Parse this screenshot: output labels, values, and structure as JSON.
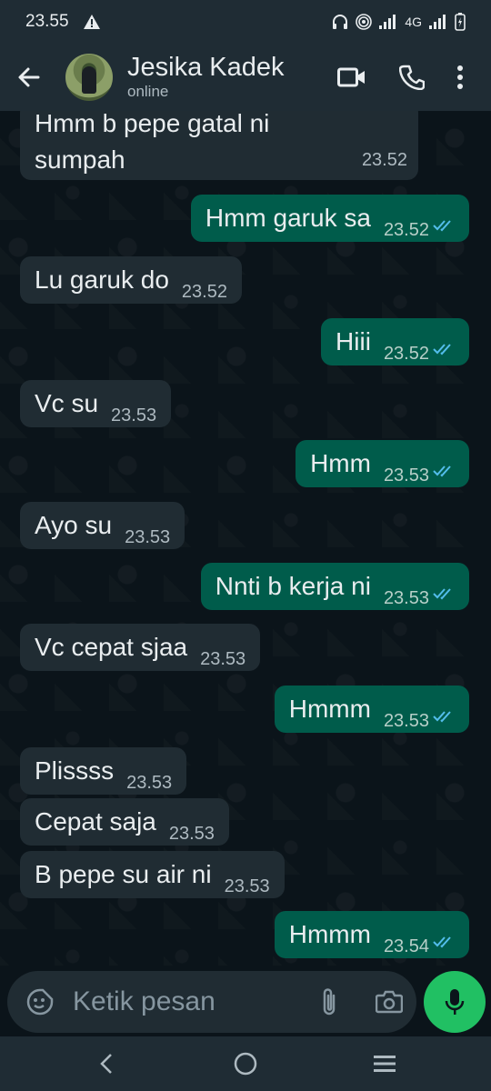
{
  "statusbar": {
    "time": "23.55",
    "network": "4G"
  },
  "header": {
    "contact_name": "Jesika Kadek",
    "contact_status": "online"
  },
  "messages": [
    {
      "dir": "in",
      "text": "Hmm b pepe gatal ni sumpah",
      "time": "23.52"
    },
    {
      "dir": "out",
      "text": "Hmm garuk sa",
      "time": "23.52",
      "read": true
    },
    {
      "dir": "in",
      "text": "Lu garuk do",
      "time": "23.52"
    },
    {
      "dir": "out",
      "text": "Hiii",
      "time": "23.52",
      "read": true
    },
    {
      "dir": "in",
      "text": "Vc su",
      "time": "23.53"
    },
    {
      "dir": "out",
      "text": "Hmm",
      "time": "23.53",
      "read": true
    },
    {
      "dir": "in",
      "text": "Ayo su",
      "time": "23.53"
    },
    {
      "dir": "out",
      "text": "Nnti b kerja ni",
      "time": "23.53",
      "read": true
    },
    {
      "dir": "in",
      "text": "Vc cepat sjaa",
      "time": "23.53"
    },
    {
      "dir": "out",
      "text": "Hmmm",
      "time": "23.53",
      "read": true
    },
    {
      "dir": "in",
      "text": "Plissss",
      "time": "23.53"
    },
    {
      "dir": "in",
      "text": "Cepat saja",
      "time": "23.53"
    },
    {
      "dir": "in",
      "text": "B pepe su air ni",
      "time": "23.53"
    },
    {
      "dir": "out",
      "text": "Hmmm",
      "time": "23.54",
      "read": true
    }
  ],
  "composer": {
    "placeholder": "Ketik pesan"
  },
  "colors": {
    "incoming": "#202c33",
    "outgoing": "#005c4b",
    "accent": "#21c063",
    "read_tick": "#53bdeb"
  },
  "icons": [
    "back-arrow-icon",
    "video-call-icon",
    "voice-call-icon",
    "more-options-icon",
    "emoji-sticker-icon",
    "attach-icon",
    "camera-icon",
    "mic-icon",
    "nav-back-icon",
    "nav-home-icon",
    "nav-recents-icon"
  ]
}
